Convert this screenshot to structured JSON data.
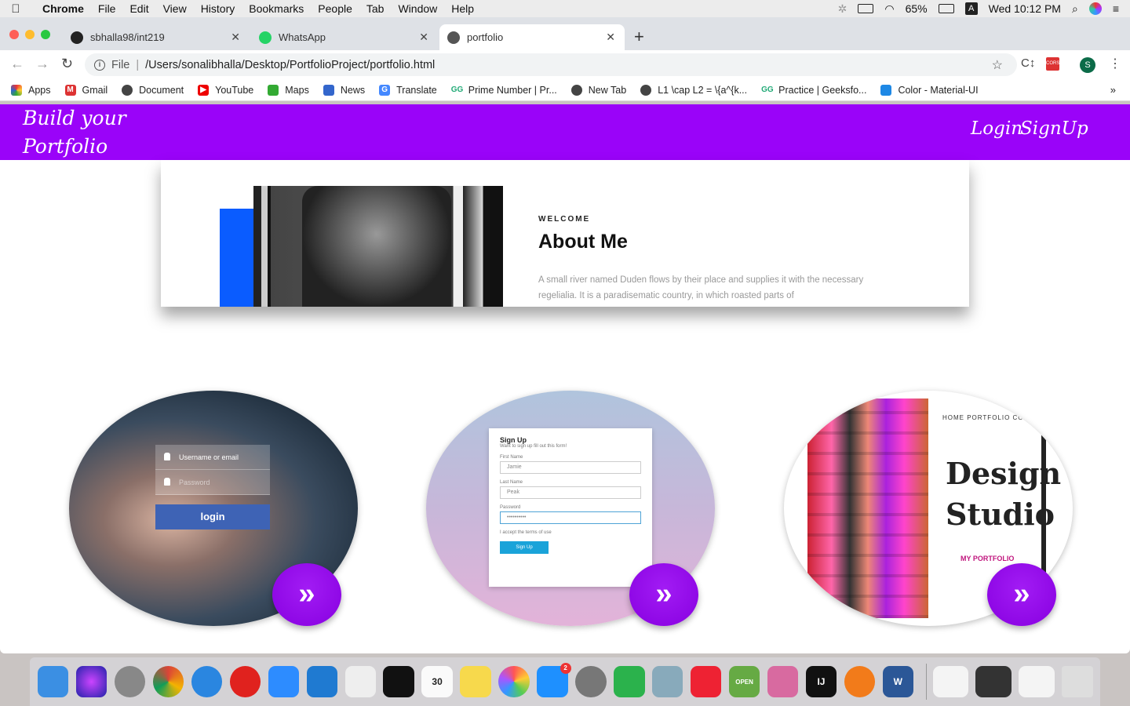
{
  "menubar": {
    "app": "Chrome",
    "items": [
      "File",
      "Edit",
      "View",
      "History",
      "Bookmarks",
      "People",
      "Tab",
      "Window",
      "Help"
    ],
    "battery": "65%",
    "input_source": "A",
    "clock": "Wed 10:12 PM"
  },
  "tabs": [
    {
      "title": "sbhalla98/int219",
      "icon": "github-icon"
    },
    {
      "title": "WhatsApp",
      "icon": "whatsapp-icon"
    },
    {
      "title": "portfolio",
      "icon": "globe-icon",
      "active": true
    }
  ],
  "address": {
    "scheme": "File",
    "url": "/Users/sonalibhalla/Desktop/PortfolioProject/portfolio.html"
  },
  "profile_initial": "S",
  "bookmarks": [
    {
      "label": "Apps",
      "icon": "apps-grid-icon",
      "color": "#e33"
    },
    {
      "label": "Gmail",
      "icon": "gmail-icon",
      "color": "#d33"
    },
    {
      "label": "Document",
      "icon": "globe-icon",
      "color": "#444"
    },
    {
      "label": "YouTube",
      "icon": "youtube-icon",
      "color": "#e00"
    },
    {
      "label": "Maps",
      "icon": "maps-icon",
      "color": "#3a3"
    },
    {
      "label": "News",
      "icon": "news-icon",
      "color": "#36c"
    },
    {
      "label": "Translate",
      "icon": "translate-icon",
      "color": "#48f"
    },
    {
      "label": "Prime Number | Pr...",
      "icon": "geeksforgeeks-icon",
      "color": "#2a7"
    },
    {
      "label": "New Tab",
      "icon": "globe-icon",
      "color": "#444"
    },
    {
      "label": "L1 \\cap L2 = \\{a^{k...",
      "icon": "globe-icon",
      "color": "#444"
    },
    {
      "label": "Practice | Geeksfo...",
      "icon": "geeksforgeeks-icon",
      "color": "#2a7"
    },
    {
      "label": "Color - Material-UI",
      "icon": "material-ui-icon",
      "color": "#1e88e5"
    }
  ],
  "page": {
    "brand_line1": "Build your",
    "brand_line2": "Portfolio",
    "login": "Login",
    "signup": "SignUp",
    "about": {
      "kicker": "WELCOME",
      "heading": "About Me",
      "text": "A small river named Duden flows by their place and supplies it with the necessary regelialia. It is a paradisematic country, in which roasted parts of"
    },
    "card1": {
      "username_placeholder": "Username or email",
      "password_placeholder": "Password",
      "button": "login"
    },
    "card2": {
      "title": "Sign Up",
      "subtitle": "Want to sign up fill out this form!",
      "first_label": "First Name",
      "first_value": "Jamie",
      "last_label": "Last Name",
      "last_value": "Peak",
      "password_label": "Password",
      "password_value": "••••••••••",
      "terms": "I accept the terms of use",
      "button": "Sign Up"
    },
    "card3": {
      "nav": "HOME  PORTFOLIO  CONTA",
      "title": "Design Studio",
      "subtitle": "MY PORTFOLIO"
    },
    "arrow_glyph": "»"
  },
  "colors": {
    "nav_purple": "#9a03f9",
    "button_purple": "#8f08e6",
    "about_blue": "#0a5cff"
  },
  "dock": [
    {
      "name": "finder-icon",
      "color": "#3b8fe3"
    },
    {
      "name": "siri-icon",
      "color": "#5b3fbf"
    },
    {
      "name": "launchpad-icon",
      "color": "#888"
    },
    {
      "name": "chrome-icon",
      "color": "#e8a33a"
    },
    {
      "name": "safari-icon",
      "color": "#2a86e0"
    },
    {
      "name": "opera-icon",
      "color": "#e0221e"
    },
    {
      "name": "zoom-icon",
      "color": "#2d8cff"
    },
    {
      "name": "vscode-icon",
      "color": "#1f7ad1"
    },
    {
      "name": "textedit-icon",
      "color": "#eee"
    },
    {
      "name": "terminal-icon",
      "color": "#111"
    },
    {
      "name": "calendar-icon",
      "color": "#fafafa"
    },
    {
      "name": "notes-icon",
      "color": "#f7d94c"
    },
    {
      "name": "photos-icon",
      "color": "#f3f3f3"
    },
    {
      "name": "app-store-icon",
      "color": "#1e90ff",
      "badge": "2"
    },
    {
      "name": "system-preferences-icon",
      "color": "#777"
    },
    {
      "name": "facetime-icon",
      "color": "#2bb24c"
    },
    {
      "name": "preview-icon",
      "color": "#8ab"
    },
    {
      "name": "anydesk-icon",
      "color": "#e23"
    },
    {
      "name": "open-sign-icon",
      "color": "#6a4"
    },
    {
      "name": "archive-utility-icon",
      "color": "#d86aa0"
    },
    {
      "name": "intellij-icon",
      "color": "#111"
    },
    {
      "name": "sketch-pen-icon",
      "color": "#f27b1a"
    },
    {
      "name": "word-icon",
      "color": "#2b5797"
    }
  ]
}
